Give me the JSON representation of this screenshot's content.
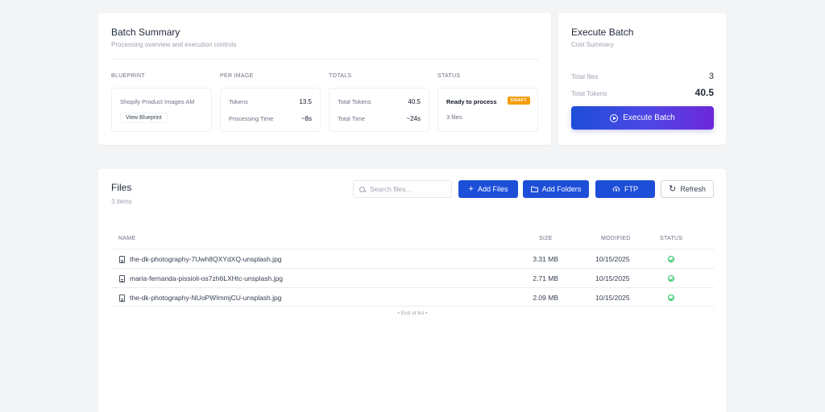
{
  "summary": {
    "title": "Batch Summary",
    "subtitle": "Processing overview and execution controls",
    "blueprint": {
      "label": "BLUEPRINT",
      "name": "Shopify Product Images AM",
      "view_button": "View Blueprint"
    },
    "per_image": {
      "label": "PER IMAGE",
      "tokens_label": "Tokens",
      "tokens_value": "13.5",
      "time_label": "Processing Time",
      "time_value": "~8s"
    },
    "totals": {
      "label": "TOTALS",
      "tokens_label": "Total Tokens",
      "tokens_value": "40.5",
      "time_label": "Total Time",
      "time_value": "~24s"
    },
    "status": {
      "label": "STATUS",
      "state": "Ready to process",
      "badge": "DRAFT",
      "files": "3 files"
    }
  },
  "execute": {
    "title": "Execute Batch",
    "subtitle": "Cost Summary",
    "total_files_label": "Total files",
    "total_files_value": "3",
    "total_tokens_label": "Total Tokens",
    "total_tokens_value": "40.5",
    "button_label": "Execute Batch"
  },
  "files": {
    "title": "Files",
    "count": "3 items",
    "search_placeholder": "Search files...",
    "buttons": {
      "add_files": "Add Files",
      "add_folders": "Add Folders",
      "ftp": "FTP",
      "refresh": "Refresh"
    },
    "columns": {
      "name": "NAME",
      "size": "SIZE",
      "modified": "MODIFIED",
      "status": "STATUS"
    },
    "rows": [
      {
        "name": "the-dk-photography-7Uwh8QXYdXQ-unsplash.jpg",
        "size": "3.31 MB",
        "modified": "10/15/2025"
      },
      {
        "name": "maria-fernanda-pissioli-os7zh6LXHtc-unsplash.jpg",
        "size": "2.71 MB",
        "modified": "10/15/2025"
      },
      {
        "name": "the-dk-photography-NUoPWImmjCU-unsplash.jpg",
        "size": "2.09 MB",
        "modified": "10/15/2025"
      }
    ],
    "end_of_list": "• End of list •"
  },
  "colors": {
    "primary": "#1d4ed8",
    "gradient_end": "#6d28d9",
    "draft": "#f59e0b",
    "success": "#22c55e"
  }
}
